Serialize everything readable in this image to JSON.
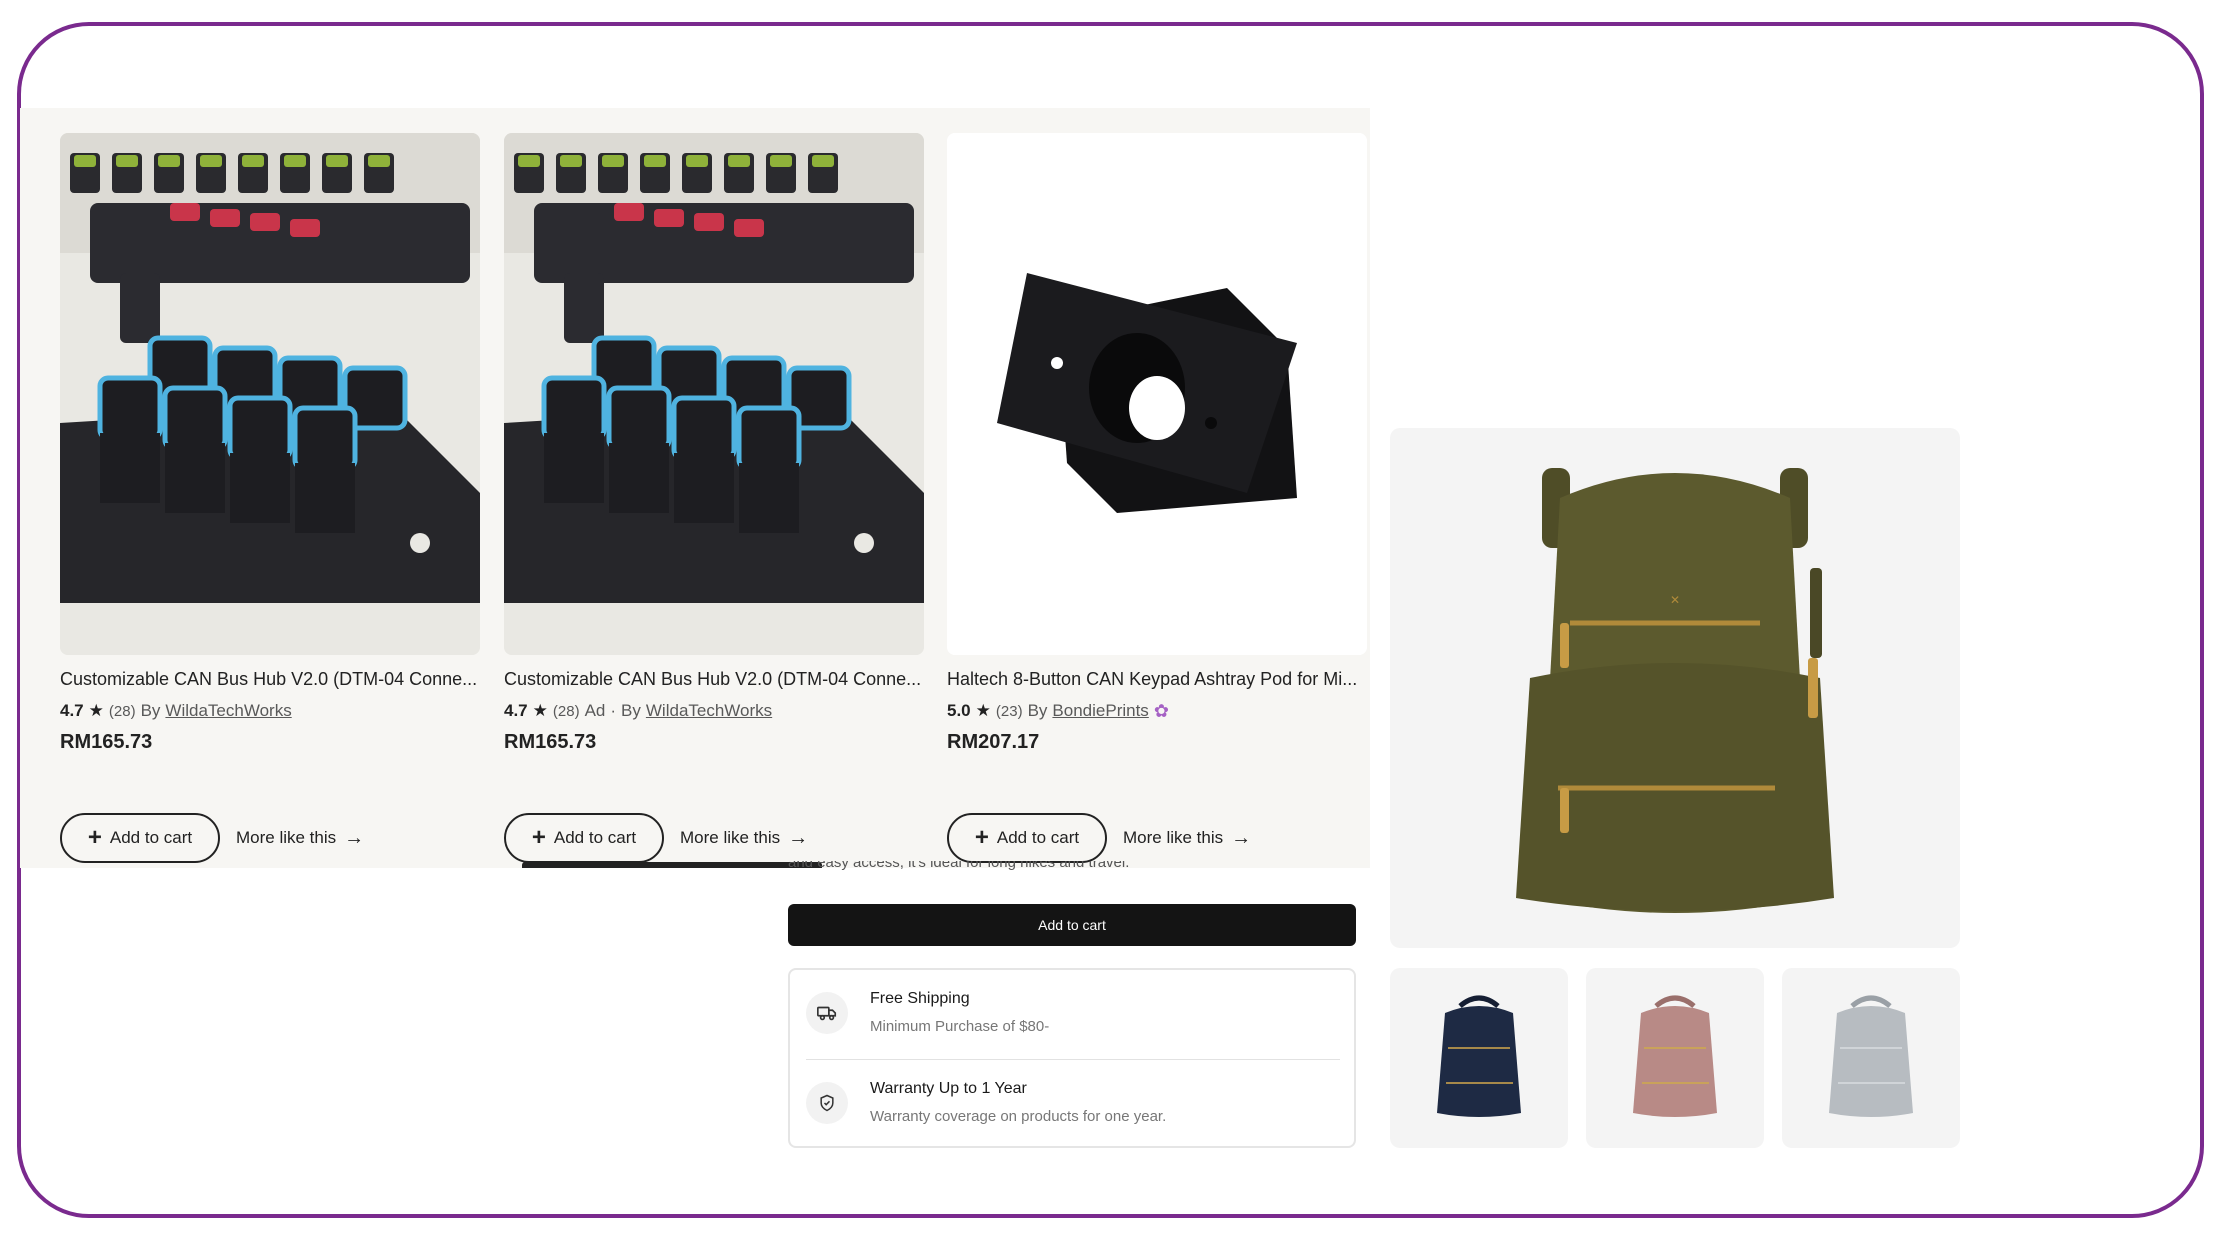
{
  "products": [
    {
      "title": "Customizable CAN Bus Hub V2.0 (DTM-04 Conne...",
      "rating": "4.7",
      "reviews": "(28)",
      "ad": "",
      "by": "By",
      "shop": "WildaTechWorks",
      "price": "RM165.73",
      "add_to_cart": "Add to cart",
      "more_like": "More like this"
    },
    {
      "title": "Customizable CAN Bus Hub V2.0 (DTM-04 Conne...",
      "rating": "4.7",
      "reviews": "(28)",
      "ad": "Ad",
      "by": "By",
      "shop": "WildaTechWorks",
      "price": "RM165.73",
      "add_to_cart": "Add to cart",
      "more_like": "More like this"
    },
    {
      "title": "Haltech 8-Button CAN Keypad Ashtray Pod for Mi...",
      "rating": "5.0",
      "reviews": "(23)",
      "ad": "",
      "by": "By",
      "shop": "BondiePrints",
      "price": "RM207.17",
      "add_to_cart": "Add to cart",
      "more_like": "More like this"
    }
  ],
  "product_page": {
    "cut_description": "and easy access, it's ideal for long hikes and travel.",
    "add_to_cart": "Add to cart",
    "shipping": {
      "title": "Free Shipping",
      "subtitle": "Minimum Purchase of $80-"
    },
    "warranty": {
      "title": "Warranty Up to 1 Year",
      "subtitle": "Warranty coverage on products for one year."
    }
  },
  "gallery": {
    "main_color": "olive",
    "thumbnails": [
      "navy",
      "rose",
      "grey"
    ]
  },
  "colors": {
    "frame": "#7a2a8e",
    "backpack_olive": "#5c5a2e",
    "backpack_navy": "#1e2a44",
    "backpack_rose": "#b88a86",
    "backpack_grey": "#b7bcc1",
    "star_seller": "#a561c4"
  },
  "icons": [
    "star-icon",
    "plus-icon",
    "arrow-right-icon",
    "star-seller-icon",
    "truck-icon",
    "shield-check-icon"
  ]
}
